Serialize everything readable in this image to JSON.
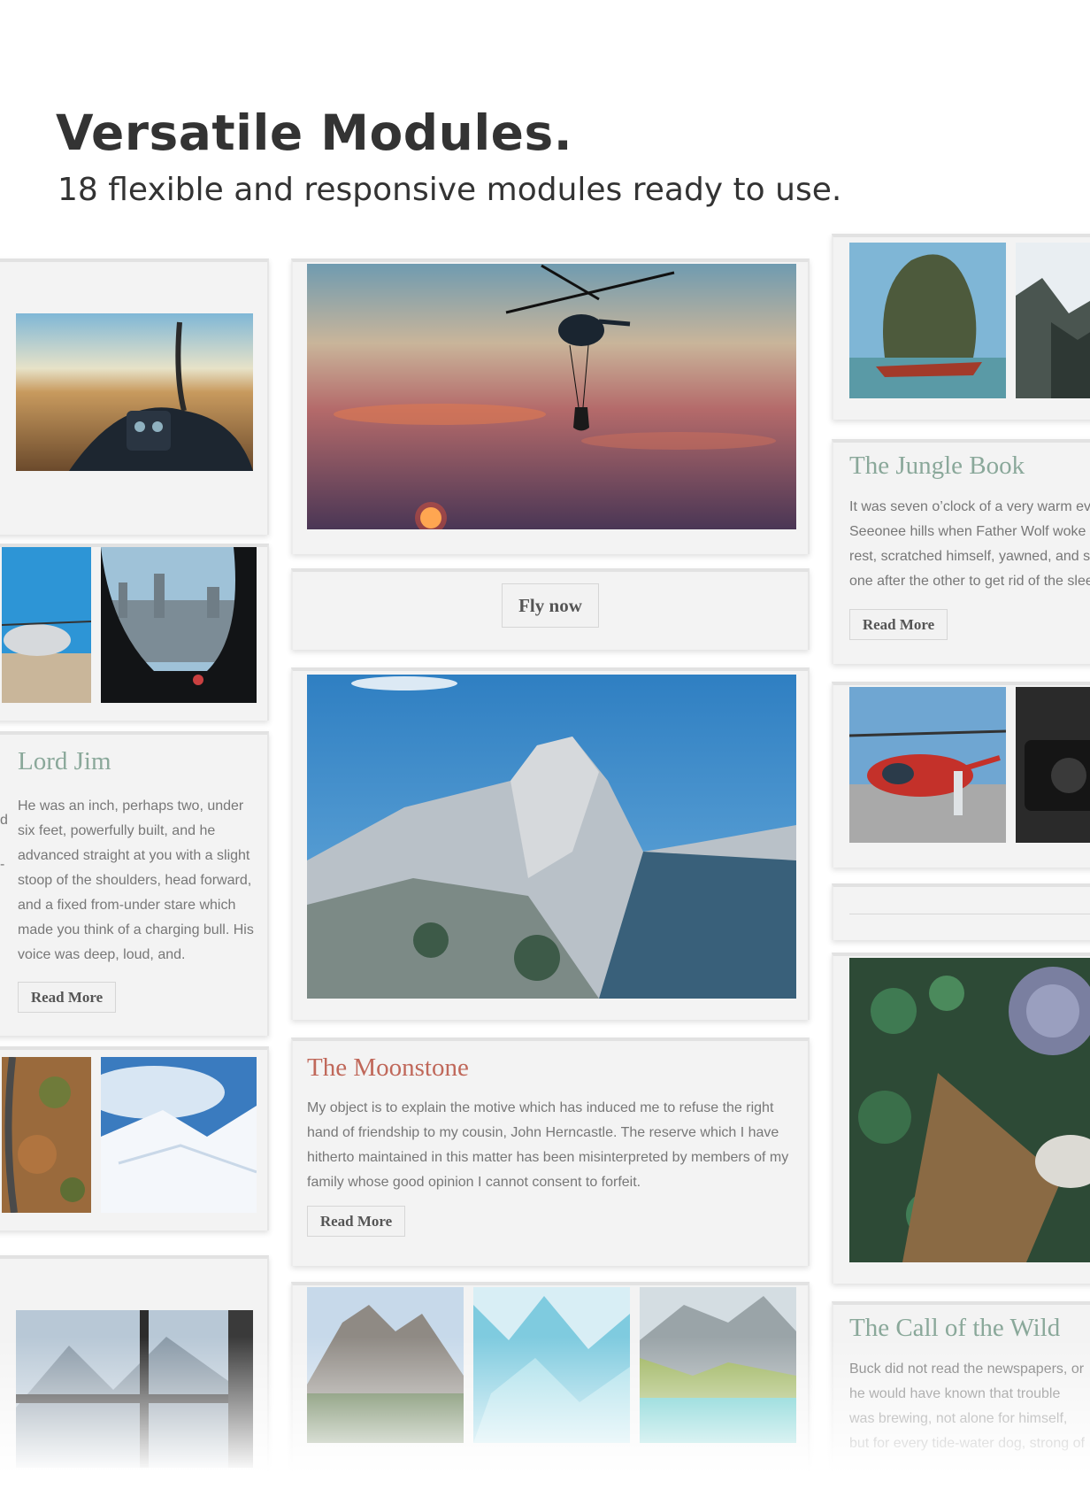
{
  "hero": {
    "title": "Versatile Modules.",
    "subtitle": "18 flexible and responsive modules ready to use."
  },
  "modules": {
    "lord_jim": {
      "title": "Lord Jim",
      "text": [
        "He was an inch, perhaps two, under",
        "six feet, powerfully built, and he",
        "advanced straight at you with a slight",
        "stoop of the shoulders, head forward,",
        "and a fixed from-under stare which",
        "made you think of a charging bull. His",
        "voice was deep, loud, and."
      ],
      "button": "Read More"
    },
    "fly_now": {
      "button": "Fly now"
    },
    "moonstone": {
      "title": "The Moonstone",
      "text": [
        "My object is to explain the motive which has induced me to refuse the right",
        "hand of friendship to my cousin, John Herncastle. The reserve which I have",
        "hitherto maintained in this matter has been misinterpreted by members of my",
        "family whose good opinion I cannot consent to forfeit."
      ],
      "button": "Read More"
    },
    "jungle_book": {
      "title": "The Jungle Book",
      "text": [
        "It was seven o’clock of a very warm ev",
        "Seeonee hills when Father Wolf woke u",
        "rest, scratched himself, yawned, and sp",
        "one after the other to get rid of the slee"
      ],
      "button": "Read More"
    },
    "call_of_wild": {
      "title": "The Call of the Wild",
      "text": [
        "Buck did not read the newspapers, or",
        "he would have known that trouble",
        "was brewing, not alone for himself,",
        "but for every tide-water dog, strong of"
      ]
    },
    "edge_fragment_text": [
      "d",
      "-"
    ]
  },
  "photos": {
    "cockpit_city": "helicopter-cockpit-over-city-photo",
    "heli_sunset": "helicopter-at-sunset-photo",
    "heli_ground": "helicopter-on-ground-photo",
    "cockpit_skyline": "cockpit-view-skyline-photo",
    "half_dome": "half-dome-mountain-photo",
    "autumn_road": "autumn-road-aerial-photo",
    "snow_mountain": "snowy-mountain-photo",
    "window_mountain": "mountain-through-window-photo",
    "dolomites": "dolomites-peaks-photo",
    "glacier_ice": "glacier-ice-photo",
    "alpine_lake": "alpine-lake-photo",
    "rock_island": "rock-island-boat-photo",
    "misty_cliff": "misty-cliff-photo",
    "red_heli": "red-helicopter-photo",
    "camera_dark": "dark-camera-photo",
    "succulents": "succulent-plants-photo"
  },
  "colors": {
    "title_green": "#8aa89a",
    "title_red": "#c0685a",
    "heading": "#333333",
    "body_text": "#777777"
  }
}
